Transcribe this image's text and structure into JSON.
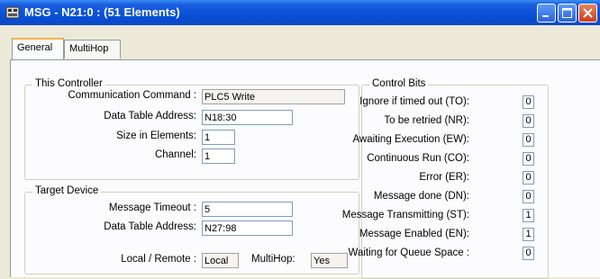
{
  "window": {
    "title": "MSG - N21:0 : (51 Elements)",
    "controls": {
      "minimize": "minimize",
      "maximize": "maximize",
      "close": "close"
    }
  },
  "tabs": [
    {
      "label": "General",
      "selected": true
    },
    {
      "label": "MultiHop",
      "selected": false
    }
  ],
  "this_controller": {
    "title": "This Controller",
    "communication_command_label": "Communication Command :",
    "communication_command_value": "PLC5 Write",
    "data_table_address_label": "Data Table Address:",
    "data_table_address_value": "N18:30",
    "size_in_elements_label": "Size in Elements:",
    "size_in_elements_value": "1",
    "channel_label": "Channel:",
    "channel_value": "1"
  },
  "target_device": {
    "title": "Target Device",
    "message_timeout_label": "Message Timeout :",
    "message_timeout_value": "5",
    "data_table_address_label": "Data Table Address:",
    "data_table_address_value": "N27:98",
    "local_remote_label": "Local / Remote :",
    "local_remote_value": "Local",
    "multihop_label": "MultiHop:",
    "multihop_value": "Yes"
  },
  "control_bits": {
    "title": "Control Bits",
    "bits": [
      {
        "label": "Ignore if timed out (TO):",
        "value": "0"
      },
      {
        "label": "To be retried (NR):",
        "value": "0"
      },
      {
        "label": "Awaiting Execution (EW):",
        "value": "0"
      },
      {
        "label": "Continuous Run (CO):",
        "value": "0"
      },
      {
        "label": "Error (ER):",
        "value": "0"
      },
      {
        "label": "Message done (DN):",
        "value": "0"
      },
      {
        "label": "Message Transmitting (ST):",
        "value": "1"
      },
      {
        "label": "Message Enabled (EN):",
        "value": "1"
      },
      {
        "label": "Waiting for Queue Space :",
        "value": "0"
      }
    ]
  },
  "colors": {
    "titlebar": "#0a4fd6",
    "dialog_bg": "#ece9d8",
    "panel_bg": "#fcfcfe",
    "close_button": "#c9401c"
  }
}
